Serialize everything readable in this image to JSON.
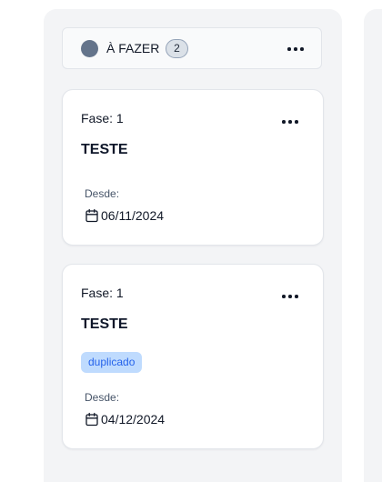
{
  "column": {
    "title": "À FAZER",
    "count": "2",
    "status_color": "#64748b"
  },
  "cards": [
    {
      "phase": "Fase: 1",
      "title": "TESTE",
      "tags": [],
      "since_label": "Desde:",
      "date": "06/11/2024"
    },
    {
      "phase": "Fase: 1",
      "title": "TESTE",
      "tags": [
        "duplicado"
      ],
      "since_label": "Desde:",
      "date": "04/12/2024"
    }
  ],
  "icons": {
    "more": "more-horizontal-icon",
    "calendar": "calendar-icon"
  },
  "colors": {
    "column_bg": "#f3f4f6",
    "tag_bg": "#bfdbfe",
    "tag_text": "#2563eb"
  }
}
